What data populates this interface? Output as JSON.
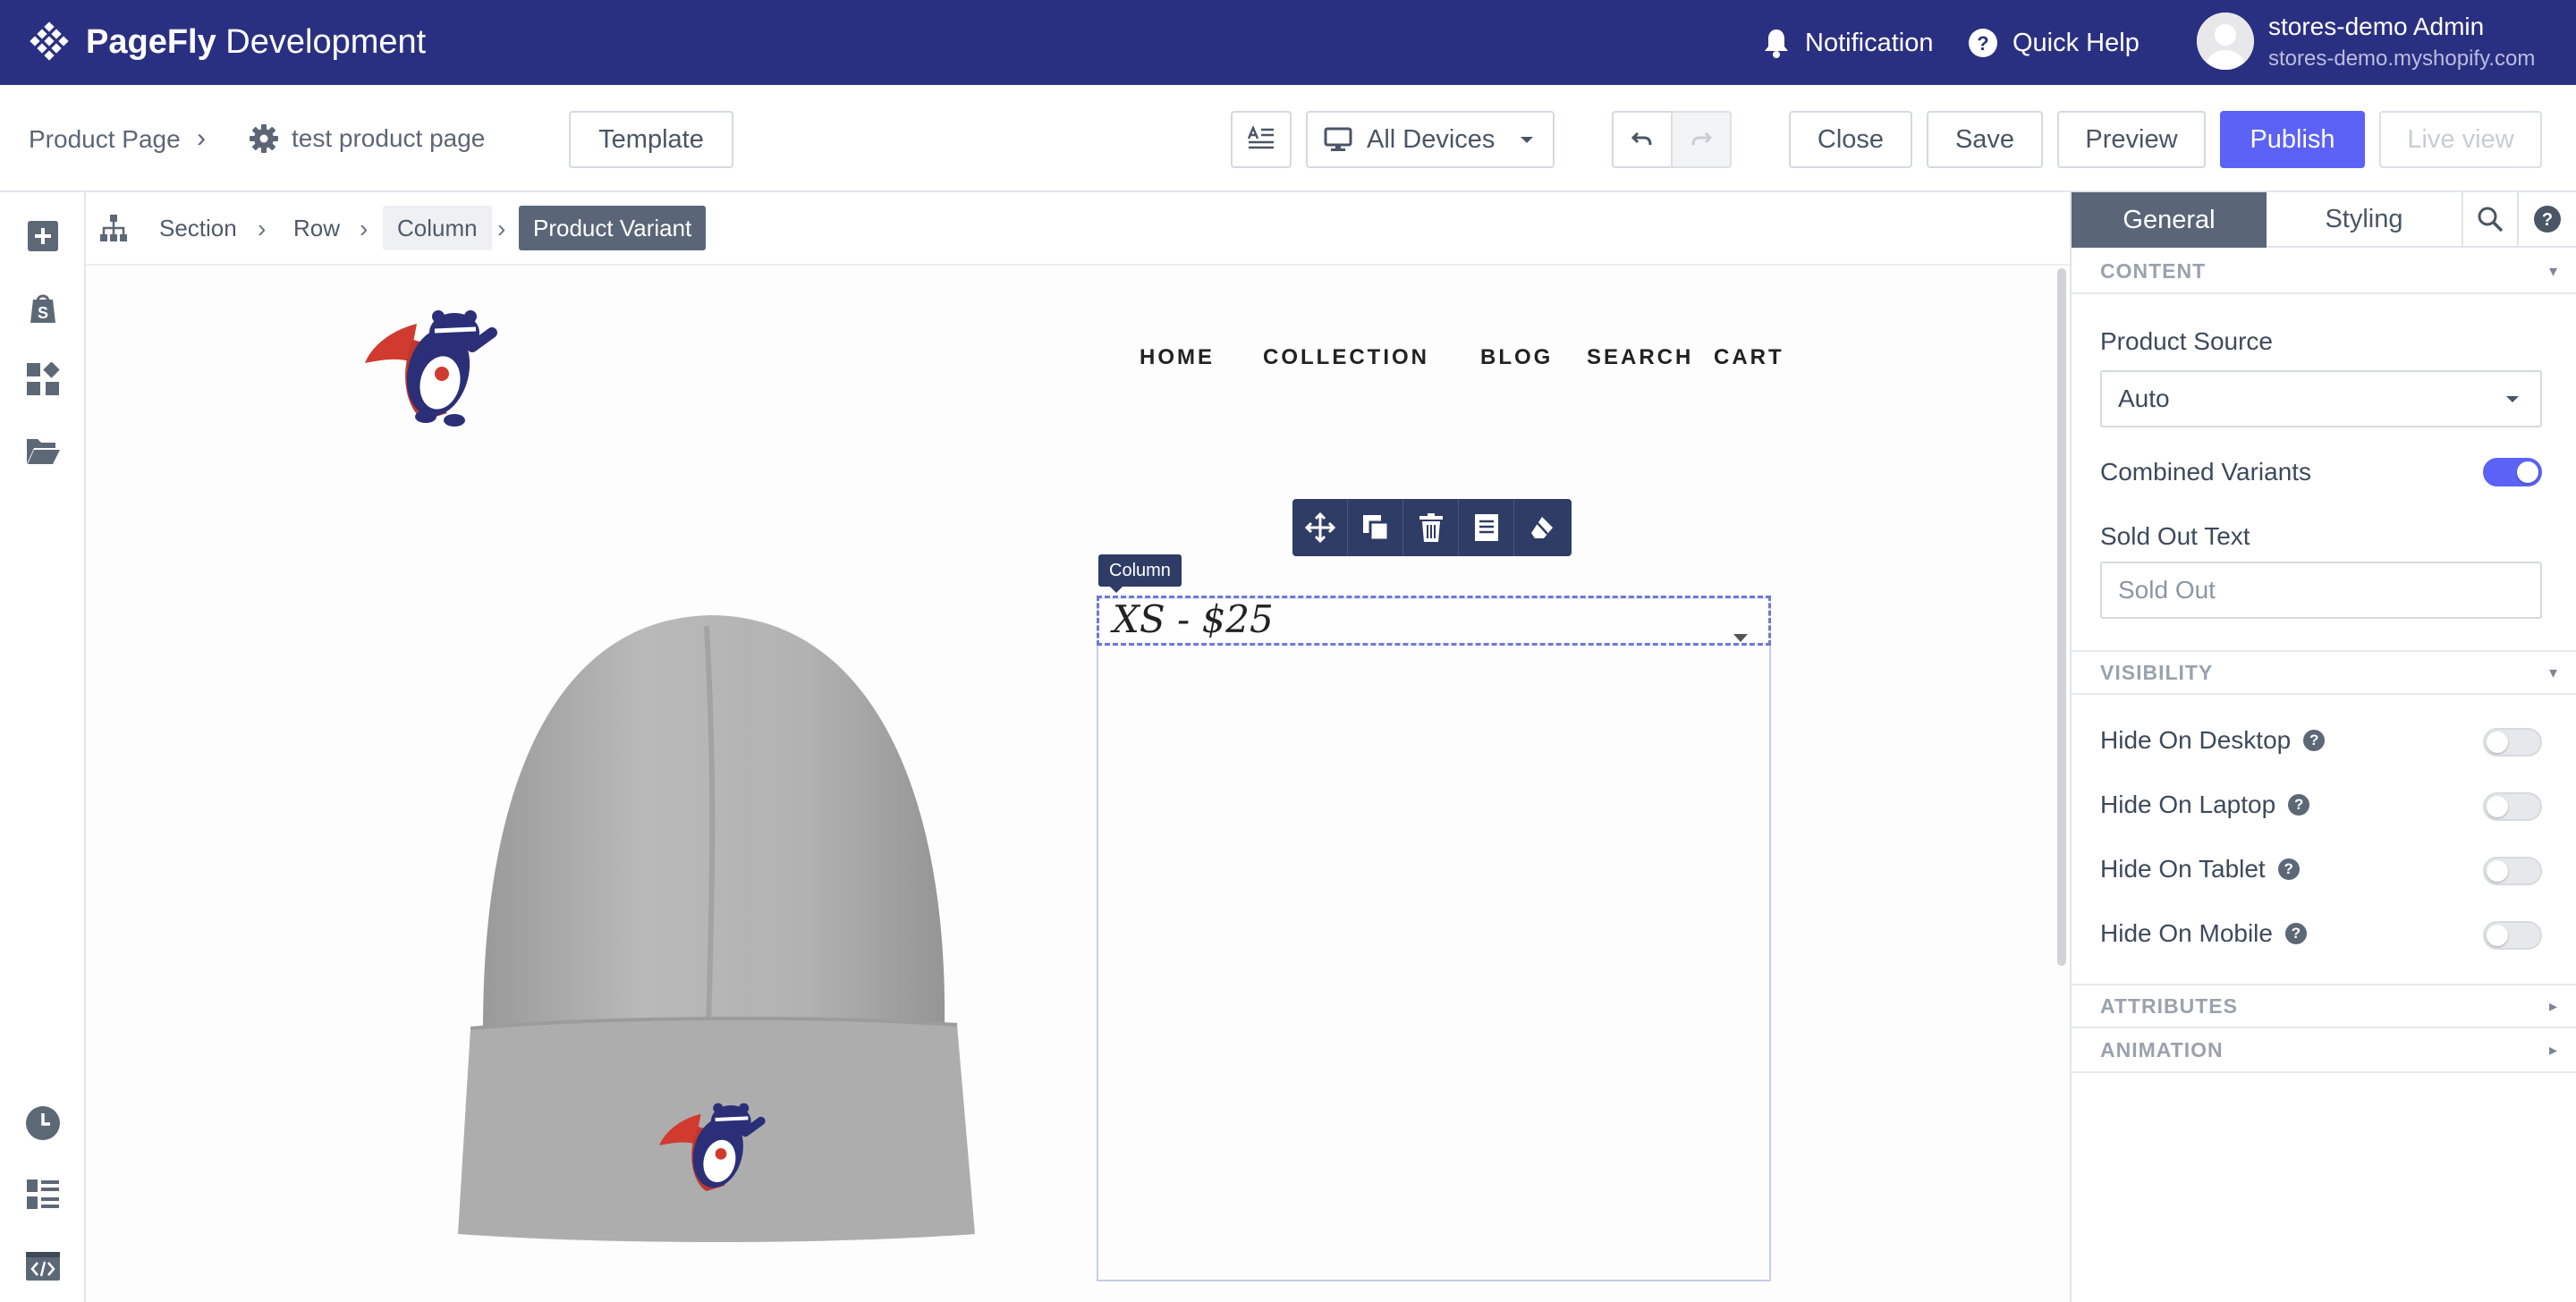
{
  "brand": {
    "bold": "PageFly",
    "light": " Development"
  },
  "top_nav": {
    "notification": "Notification",
    "quick_help": "Quick Help",
    "user_name": "stores-demo Admin",
    "user_store": "stores-demo.myshopify.com"
  },
  "toolbar": {
    "breadcrumb_root": "Product Page",
    "page_name": "test product page",
    "template_label": "Template",
    "devices_label": "All Devices",
    "close_label": "Close",
    "save_label": "Save",
    "preview_label": "Preview",
    "publish_label": "Publish",
    "live_view_label": "Live view"
  },
  "path": {
    "items": [
      "Section",
      "Row",
      "Column",
      "Product Variant"
    ]
  },
  "canvas": {
    "nav_links": [
      "HOME",
      "COLLECTION",
      "BLOG",
      "SEARCH",
      "CART"
    ],
    "column_tag": "Column",
    "variant_value": "XS - $25"
  },
  "panel": {
    "tabs": {
      "general": "General",
      "styling": "Styling"
    },
    "content_header": "CONTENT",
    "product_source_label": "Product Source",
    "product_source_value": "Auto",
    "combined_variants_label": "Combined Variants",
    "combined_variants_on": true,
    "sold_out_label": "Sold Out Text",
    "sold_out_placeholder": "Sold Out",
    "visibility_header": "VISIBILITY",
    "visibility": [
      {
        "label": "Hide On Desktop",
        "on": false
      },
      {
        "label": "Hide On Laptop",
        "on": false
      },
      {
        "label": "Hide On Tablet",
        "on": false
      },
      {
        "label": "Hide On Mobile",
        "on": false
      }
    ],
    "attributes_header": "ATTRIBUTES",
    "animation_header": "ANIMATION"
  },
  "colors": {
    "topbar": "#2a3081",
    "accent": "#5b62f5",
    "tab_active": "#5a6678",
    "widget_toolbar": "#2f3c66"
  },
  "icons": [
    "pagefly-logo-icon",
    "bell-icon",
    "help-circle-icon",
    "add-element-icon",
    "shopify-bag-icon",
    "apps-icon",
    "folder-icon",
    "history-icon",
    "layers-icon",
    "code-icon",
    "settings-gear-icon",
    "monitor-icon",
    "undo-icon",
    "redo-icon",
    "text-align-icon",
    "sitemap-icon",
    "move-icon",
    "duplicate-icon",
    "delete-icon",
    "save-snippet-icon",
    "eraser-icon",
    "search-icon"
  ]
}
